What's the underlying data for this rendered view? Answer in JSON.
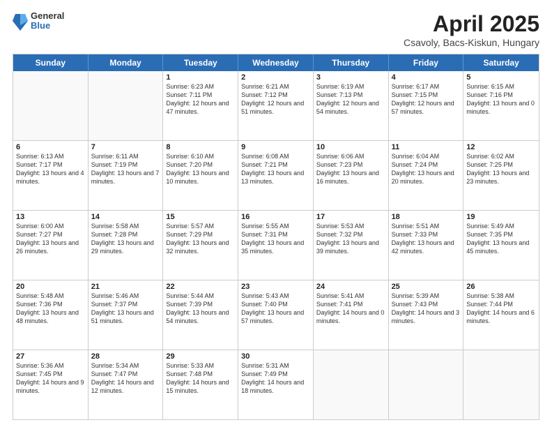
{
  "header": {
    "logo": {
      "general": "General",
      "blue": "Blue"
    },
    "title": "April 2025",
    "location": "Csavoly, Bacs-Kiskun, Hungary"
  },
  "calendar": {
    "days_of_week": [
      "Sunday",
      "Monday",
      "Tuesday",
      "Wednesday",
      "Thursday",
      "Friday",
      "Saturday"
    ],
    "rows": [
      [
        {
          "day": "",
          "text": ""
        },
        {
          "day": "",
          "text": ""
        },
        {
          "day": "1",
          "text": "Sunrise: 6:23 AM\nSunset: 7:11 PM\nDaylight: 12 hours and 47 minutes."
        },
        {
          "day": "2",
          "text": "Sunrise: 6:21 AM\nSunset: 7:12 PM\nDaylight: 12 hours and 51 minutes."
        },
        {
          "day": "3",
          "text": "Sunrise: 6:19 AM\nSunset: 7:13 PM\nDaylight: 12 hours and 54 minutes."
        },
        {
          "day": "4",
          "text": "Sunrise: 6:17 AM\nSunset: 7:15 PM\nDaylight: 12 hours and 57 minutes."
        },
        {
          "day": "5",
          "text": "Sunrise: 6:15 AM\nSunset: 7:16 PM\nDaylight: 13 hours and 0 minutes."
        }
      ],
      [
        {
          "day": "6",
          "text": "Sunrise: 6:13 AM\nSunset: 7:17 PM\nDaylight: 13 hours and 4 minutes."
        },
        {
          "day": "7",
          "text": "Sunrise: 6:11 AM\nSunset: 7:19 PM\nDaylight: 13 hours and 7 minutes."
        },
        {
          "day": "8",
          "text": "Sunrise: 6:10 AM\nSunset: 7:20 PM\nDaylight: 13 hours and 10 minutes."
        },
        {
          "day": "9",
          "text": "Sunrise: 6:08 AM\nSunset: 7:21 PM\nDaylight: 13 hours and 13 minutes."
        },
        {
          "day": "10",
          "text": "Sunrise: 6:06 AM\nSunset: 7:23 PM\nDaylight: 13 hours and 16 minutes."
        },
        {
          "day": "11",
          "text": "Sunrise: 6:04 AM\nSunset: 7:24 PM\nDaylight: 13 hours and 20 minutes."
        },
        {
          "day": "12",
          "text": "Sunrise: 6:02 AM\nSunset: 7:25 PM\nDaylight: 13 hours and 23 minutes."
        }
      ],
      [
        {
          "day": "13",
          "text": "Sunrise: 6:00 AM\nSunset: 7:27 PM\nDaylight: 13 hours and 26 minutes."
        },
        {
          "day": "14",
          "text": "Sunrise: 5:58 AM\nSunset: 7:28 PM\nDaylight: 13 hours and 29 minutes."
        },
        {
          "day": "15",
          "text": "Sunrise: 5:57 AM\nSunset: 7:29 PM\nDaylight: 13 hours and 32 minutes."
        },
        {
          "day": "16",
          "text": "Sunrise: 5:55 AM\nSunset: 7:31 PM\nDaylight: 13 hours and 35 minutes."
        },
        {
          "day": "17",
          "text": "Sunrise: 5:53 AM\nSunset: 7:32 PM\nDaylight: 13 hours and 39 minutes."
        },
        {
          "day": "18",
          "text": "Sunrise: 5:51 AM\nSunset: 7:33 PM\nDaylight: 13 hours and 42 minutes."
        },
        {
          "day": "19",
          "text": "Sunrise: 5:49 AM\nSunset: 7:35 PM\nDaylight: 13 hours and 45 minutes."
        }
      ],
      [
        {
          "day": "20",
          "text": "Sunrise: 5:48 AM\nSunset: 7:36 PM\nDaylight: 13 hours and 48 minutes."
        },
        {
          "day": "21",
          "text": "Sunrise: 5:46 AM\nSunset: 7:37 PM\nDaylight: 13 hours and 51 minutes."
        },
        {
          "day": "22",
          "text": "Sunrise: 5:44 AM\nSunset: 7:39 PM\nDaylight: 13 hours and 54 minutes."
        },
        {
          "day": "23",
          "text": "Sunrise: 5:43 AM\nSunset: 7:40 PM\nDaylight: 13 hours and 57 minutes."
        },
        {
          "day": "24",
          "text": "Sunrise: 5:41 AM\nSunset: 7:41 PM\nDaylight: 14 hours and 0 minutes."
        },
        {
          "day": "25",
          "text": "Sunrise: 5:39 AM\nSunset: 7:43 PM\nDaylight: 14 hours and 3 minutes."
        },
        {
          "day": "26",
          "text": "Sunrise: 5:38 AM\nSunset: 7:44 PM\nDaylight: 14 hours and 6 minutes."
        }
      ],
      [
        {
          "day": "27",
          "text": "Sunrise: 5:36 AM\nSunset: 7:45 PM\nDaylight: 14 hours and 9 minutes."
        },
        {
          "day": "28",
          "text": "Sunrise: 5:34 AM\nSunset: 7:47 PM\nDaylight: 14 hours and 12 minutes."
        },
        {
          "day": "29",
          "text": "Sunrise: 5:33 AM\nSunset: 7:48 PM\nDaylight: 14 hours and 15 minutes."
        },
        {
          "day": "30",
          "text": "Sunrise: 5:31 AM\nSunset: 7:49 PM\nDaylight: 14 hours and 18 minutes."
        },
        {
          "day": "",
          "text": ""
        },
        {
          "day": "",
          "text": ""
        },
        {
          "day": "",
          "text": ""
        }
      ]
    ]
  }
}
